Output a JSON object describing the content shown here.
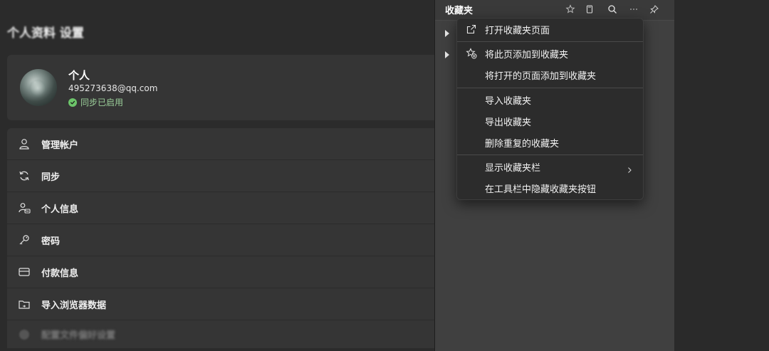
{
  "settings": {
    "heading": "个人资料 设置",
    "profile": {
      "name": "个人",
      "email": "495273638@qq.com",
      "sync_status": "同步已启用"
    },
    "menu_items": [
      {
        "label": "管理帐户",
        "icon": "user-icon"
      },
      {
        "label": "同步",
        "icon": "sync-icon"
      },
      {
        "label": "个人信息",
        "icon": "contact-card-icon"
      },
      {
        "label": "密码",
        "icon": "key-icon"
      },
      {
        "label": "付款信息",
        "icon": "credit-card-icon"
      },
      {
        "label": "导入浏览器数据",
        "icon": "import-folder-icon"
      },
      {
        "label": "配置文件偏好设置",
        "icon": "profile-icon"
      }
    ]
  },
  "favorites": {
    "title": "收藏夹",
    "header_icons": [
      "add-favorite-icon",
      "add-folder-icon",
      "search-icon",
      "more-icon",
      "pin-icon"
    ]
  },
  "context_menu": {
    "items": [
      {
        "label": "打开收藏夹页面",
        "icon": "open-external-icon"
      },
      {
        "label": "将此页添加到收藏夹",
        "icon": "star-add-icon"
      },
      {
        "label": "将打开的页面添加到收藏夹",
        "icon": ""
      },
      {
        "label": "导入收藏夹",
        "icon": ""
      },
      {
        "label": "导出收藏夹",
        "icon": ""
      },
      {
        "label": "删除重复的收藏夹",
        "icon": ""
      },
      {
        "label": "显示收藏夹栏",
        "icon": "",
        "has_submenu": true
      },
      {
        "label": "在工具栏中隐藏收藏夹按钮",
        "icon": ""
      }
    ]
  },
  "colors": {
    "background": "#2b2b2b",
    "card": "#353535",
    "panel": "#404040",
    "menu": "#2c2c2c",
    "sync_green": "#6cc46a"
  }
}
